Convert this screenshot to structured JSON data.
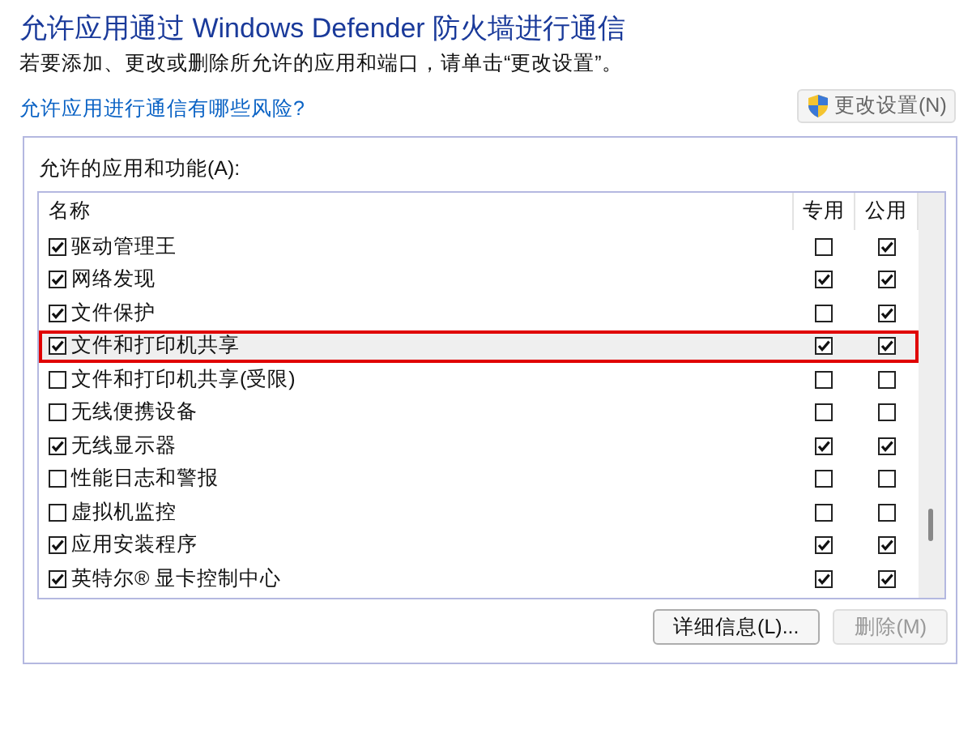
{
  "title": "允许应用通过 Windows Defender 防火墙进行通信",
  "subtitle": "若要添加、更改或删除所允许的应用和端口，请单击“更改设置”。",
  "risk_link": "允许应用进行通信有哪些风险?",
  "change_settings_button": {
    "label": "更改设置(N)",
    "disabled": true
  },
  "group": {
    "label": "允许的应用和功能(A):",
    "columns": [
      "名称",
      "专用",
      "公用"
    ],
    "rows": [
      {
        "name": "驱动管理王",
        "checked": true,
        "private": false,
        "public": true,
        "selected": false
      },
      {
        "name": "网络发现",
        "checked": true,
        "private": true,
        "public": true,
        "selected": false
      },
      {
        "name": "文件保护",
        "checked": true,
        "private": false,
        "public": true,
        "selected": false
      },
      {
        "name": "文件和打印机共享",
        "checked": true,
        "private": true,
        "public": true,
        "selected": true
      },
      {
        "name": "文件和打印机共享(受限)",
        "checked": false,
        "private": false,
        "public": false,
        "selected": false
      },
      {
        "name": "无线便携设备",
        "checked": false,
        "private": false,
        "public": false,
        "selected": false
      },
      {
        "name": "无线显示器",
        "checked": true,
        "private": true,
        "public": true,
        "selected": false
      },
      {
        "name": "性能日志和警报",
        "checked": false,
        "private": false,
        "public": false,
        "selected": false
      },
      {
        "name": "虚拟机监控",
        "checked": false,
        "private": false,
        "public": false,
        "selected": false
      },
      {
        "name": "应用安装程序",
        "checked": true,
        "private": true,
        "public": true,
        "selected": false
      },
      {
        "name": "英特尔® 显卡控制中心",
        "checked": true,
        "private": true,
        "public": true,
        "selected": false
      }
    ],
    "buttons": [
      {
        "label": "详细信息(L)...",
        "disabled": false
      },
      {
        "label": "删除(M)",
        "disabled": true
      }
    ]
  }
}
